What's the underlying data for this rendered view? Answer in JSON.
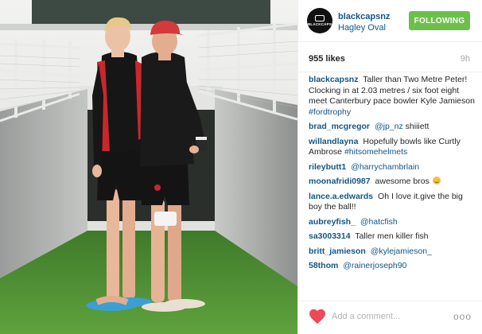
{
  "post": {
    "owner": "blackcapsnz",
    "location": "Hagley Oval",
    "avatar_text": [
      "BLACKCAPS"
    ],
    "follow_label": "FOLLOWING",
    "likes": "955 likes",
    "age": "9h"
  },
  "comments": [
    {
      "user": "blackcapsnz",
      "text": "Taller than Two Metre Peter! Clocking in at 2.03 metres / six foot eight meet Canterbury pace bowler Kyle Jamieson",
      "link": "#fordtrophy"
    },
    {
      "user": "brad_mcgregor",
      "link": "@jp_nz",
      "text": "shiiiett"
    },
    {
      "user": "willandlayna",
      "text": "Hopefully bowls like Curtly Ambrose",
      "link": "#hitsomehelmets"
    },
    {
      "user": "rileybutt1",
      "link": "@harrychambrlain"
    },
    {
      "user": "moonafridi0987",
      "text": "awesome bros",
      "emoji": "smile-emoji"
    },
    {
      "user": "lance.a.edwards",
      "text": "Oh I love it.give the big boy the ball!!"
    },
    {
      "user": "aubreyfish_",
      "link": "@hatcfish"
    },
    {
      "user": "sa3003314",
      "text": "Taller men killer fish"
    },
    {
      "user": "britt_jamieson",
      "link": "@kylejamieson_"
    },
    {
      "user": "58thom",
      "link": "@rainerjoseph90"
    }
  ],
  "footer": {
    "like_icon": "heart-icon",
    "comment_placeholder": "Add a comment...",
    "more_label": "ooo"
  },
  "colors": {
    "link": "#125688",
    "follow": "#6cc04a",
    "heart": "#ed4956"
  }
}
